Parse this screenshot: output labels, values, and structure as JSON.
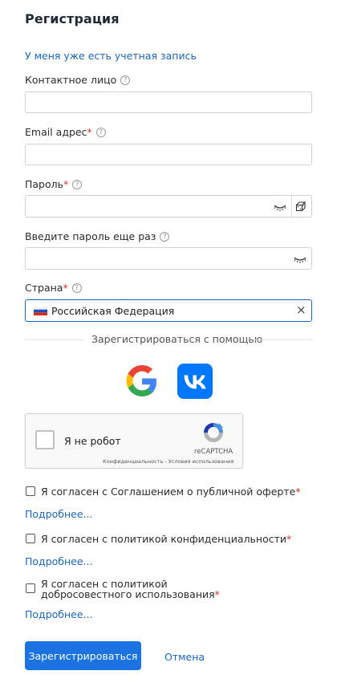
{
  "form": {
    "title": "Регистрация",
    "login_link": "У меня уже есть учетная запись"
  },
  "fields": {
    "contact": {
      "label": "Контактное лицо",
      "value": ""
    },
    "email": {
      "label": "Email адрес",
      "required_mark": "*",
      "value": ""
    },
    "password": {
      "label": "Пароль",
      "required_mark": "*",
      "value": ""
    },
    "password_repeat": {
      "label": "Введите пароль еще раз",
      "value": ""
    },
    "country": {
      "label": "Страна",
      "required_mark": "*",
      "value": "Российская Федерация",
      "clear_glyph": "×"
    }
  },
  "help_glyph": "?",
  "social": {
    "divider_text": "Зарегистрироваться с помощью",
    "providers": [
      "google-icon",
      "vk-icon"
    ],
    "vk_color": "#0077ff"
  },
  "captcha": {
    "label": "Я не робот",
    "brand": "reCAPTCHA",
    "privacy": "Конфиденциальность",
    "dot": " - ",
    "terms": "Условия использования"
  },
  "agreements": [
    {
      "text": "Я согласен с Соглашением о публичной оферте",
      "required_mark": "*",
      "more": "Подробнее..."
    },
    {
      "text": "Я согласен с политикой конфиденциальности",
      "required_mark": "*",
      "more": "Подробнее..."
    },
    {
      "text": "Я согласен с политикой добросовестного использования",
      "required_mark": "*",
      "more": "Подробнее..."
    }
  ],
  "actions": {
    "submit": "Зарегистрироваться",
    "cancel": "Отмена"
  },
  "colors": {
    "accent": "#1a73e0",
    "link": "#1a66c6",
    "required": "#d4312b"
  }
}
